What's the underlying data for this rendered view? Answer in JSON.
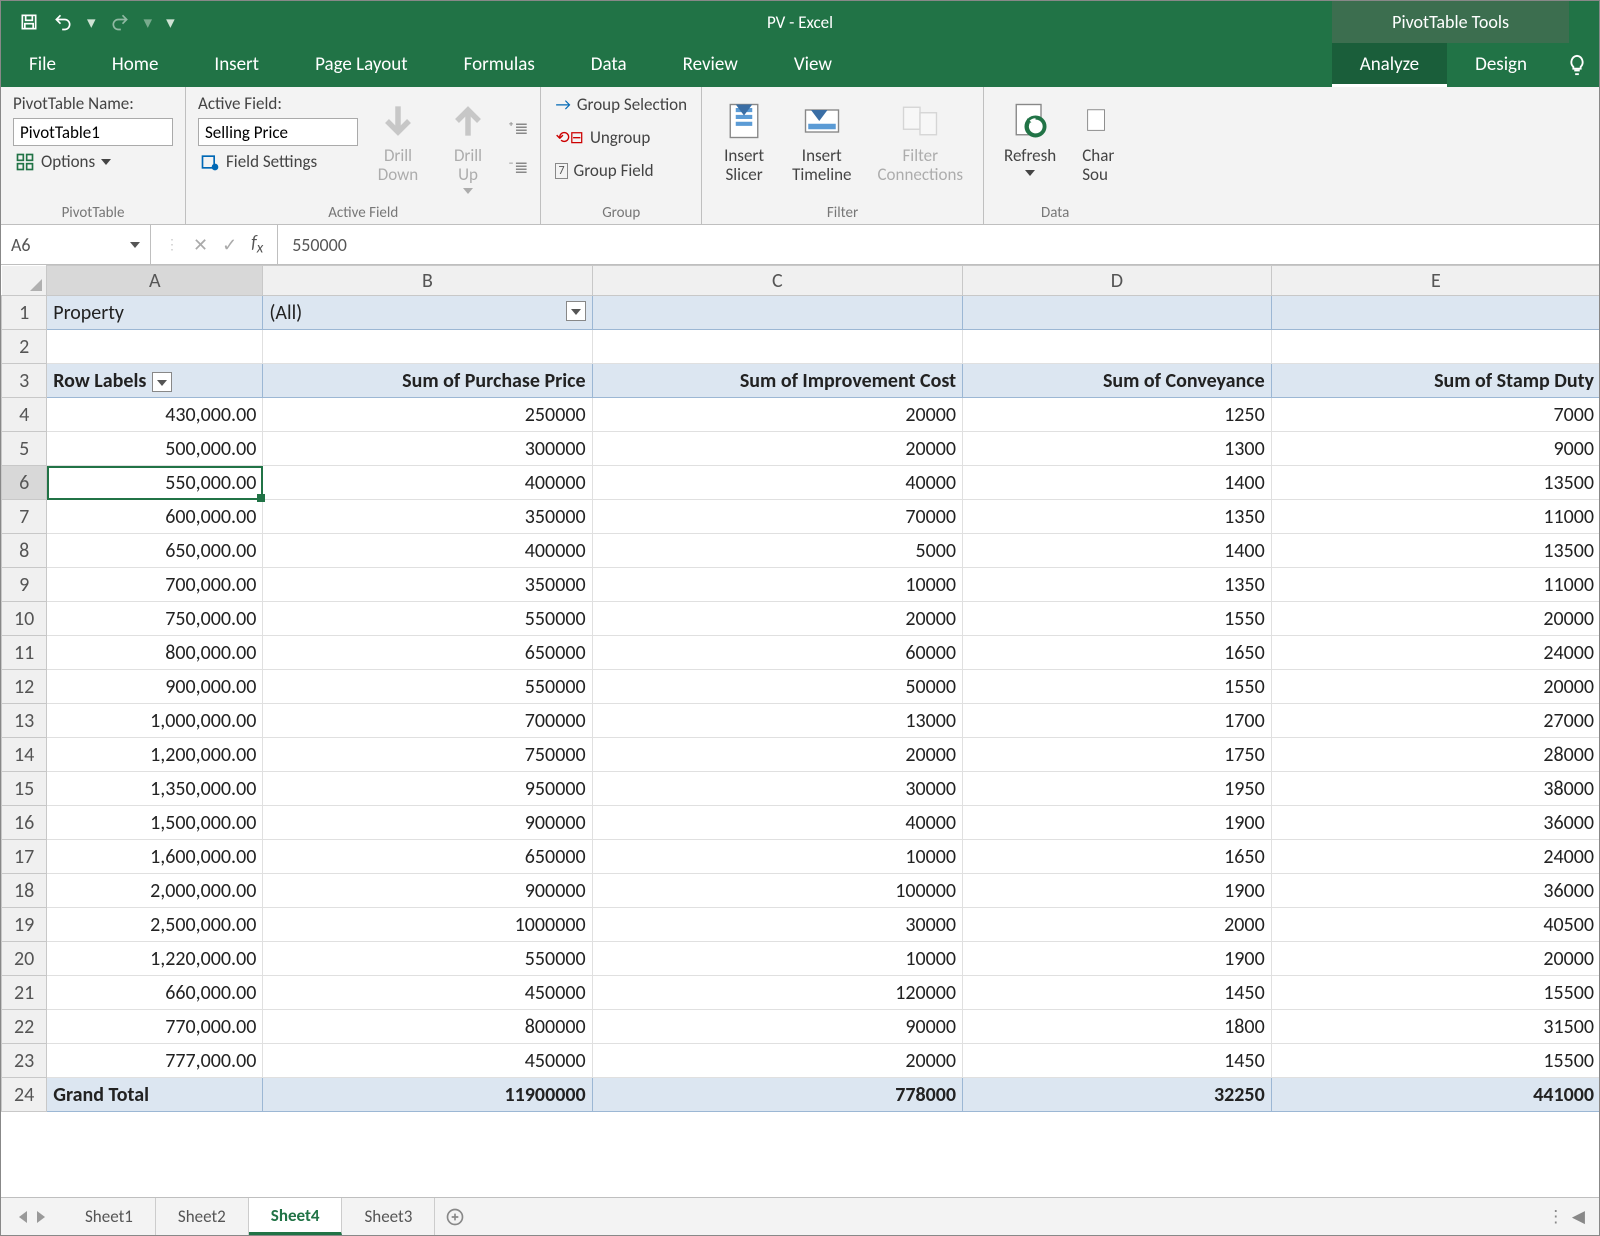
{
  "app": {
    "title": "PV - Excel",
    "context_tools": "PivotTable Tools"
  },
  "qat": {
    "save": "save",
    "undo": "undo",
    "redo": "redo"
  },
  "tabs": {
    "main": [
      "File",
      "Home",
      "Insert",
      "Page Layout",
      "Formulas",
      "Data",
      "Review",
      "View"
    ],
    "context": [
      "Analyze",
      "Design"
    ],
    "active": "Analyze"
  },
  "ribbon": {
    "pivottable": {
      "name_label": "PivotTable Name:",
      "name_value": "PivotTable1",
      "options": "Options",
      "group": "PivotTable"
    },
    "activefield": {
      "label": "Active Field:",
      "value": "Selling Price",
      "settings": "Field Settings",
      "drilldown": "Drill Down",
      "drillup": "Drill Up",
      "group": "Active Field"
    },
    "group": {
      "selection": "Group Selection",
      "ungroup": "Ungroup",
      "field": "Group Field",
      "group": "Group"
    },
    "filter": {
      "slicer": "Insert Slicer",
      "timeline": "Insert Timeline",
      "connections": "Filter Connections",
      "group": "Filter"
    },
    "data": {
      "refresh": "Refresh",
      "change": "Chan Sou",
      "group": "Data"
    }
  },
  "formula_bar": {
    "cell": "A6",
    "value": "550000"
  },
  "columns": [
    "A",
    "B",
    "C",
    "D",
    "E"
  ],
  "pivot": {
    "filter_field": "Property",
    "filter_value": "(All)",
    "headers": [
      "Row Labels",
      "Sum of Purchase Price",
      "Sum of Improvement Cost",
      "Sum of Conveyance",
      "Sum of Stamp Duty"
    ],
    "rows": [
      {
        "n": 4,
        "a": "430,000.00",
        "b": "250000",
        "c": "20000",
        "d": "1250",
        "e": "7000"
      },
      {
        "n": 5,
        "a": "500,000.00",
        "b": "300000",
        "c": "20000",
        "d": "1300",
        "e": "9000"
      },
      {
        "n": 6,
        "a": "550,000.00",
        "b": "400000",
        "c": "40000",
        "d": "1400",
        "e": "13500",
        "sel": true
      },
      {
        "n": 7,
        "a": "600,000.00",
        "b": "350000",
        "c": "70000",
        "d": "1350",
        "e": "11000"
      },
      {
        "n": 8,
        "a": "650,000.00",
        "b": "400000",
        "c": "5000",
        "d": "1400",
        "e": "13500"
      },
      {
        "n": 9,
        "a": "700,000.00",
        "b": "350000",
        "c": "10000",
        "d": "1350",
        "e": "11000"
      },
      {
        "n": 10,
        "a": "750,000.00",
        "b": "550000",
        "c": "20000",
        "d": "1550",
        "e": "20000"
      },
      {
        "n": 11,
        "a": "800,000.00",
        "b": "650000",
        "c": "60000",
        "d": "1650",
        "e": "24000"
      },
      {
        "n": 12,
        "a": "900,000.00",
        "b": "550000",
        "c": "50000",
        "d": "1550",
        "e": "20000"
      },
      {
        "n": 13,
        "a": "1,000,000.00",
        "b": "700000",
        "c": "13000",
        "d": "1700",
        "e": "27000"
      },
      {
        "n": 14,
        "a": "1,200,000.00",
        "b": "750000",
        "c": "20000",
        "d": "1750",
        "e": "28000"
      },
      {
        "n": 15,
        "a": "1,350,000.00",
        "b": "950000",
        "c": "30000",
        "d": "1950",
        "e": "38000"
      },
      {
        "n": 16,
        "a": "1,500,000.00",
        "b": "900000",
        "c": "40000",
        "d": "1900",
        "e": "36000"
      },
      {
        "n": 17,
        "a": "1,600,000.00",
        "b": "650000",
        "c": "10000",
        "d": "1650",
        "e": "24000"
      },
      {
        "n": 18,
        "a": "2,000,000.00",
        "b": "900000",
        "c": "100000",
        "d": "1900",
        "e": "36000"
      },
      {
        "n": 19,
        "a": "2,500,000.00",
        "b": "1000000",
        "c": "30000",
        "d": "2000",
        "e": "40500"
      },
      {
        "n": 20,
        "a": "1,220,000.00",
        "b": "550000",
        "c": "10000",
        "d": "1900",
        "e": "20000"
      },
      {
        "n": 21,
        "a": "660,000.00",
        "b": "450000",
        "c": "120000",
        "d": "1450",
        "e": "15500"
      },
      {
        "n": 22,
        "a": "770,000.00",
        "b": "800000",
        "c": "90000",
        "d": "1800",
        "e": "31500"
      },
      {
        "n": 23,
        "a": "777,000.00",
        "b": "450000",
        "c": "20000",
        "d": "1450",
        "e": "15500"
      }
    ],
    "grand": {
      "n": 24,
      "label": "Grand Total",
      "b": "11900000",
      "c": "778000",
      "d": "32250",
      "e": "441000"
    }
  },
  "sheets": {
    "list": [
      "Sheet1",
      "Sheet2",
      "Sheet4",
      "Sheet3"
    ],
    "active": "Sheet4"
  }
}
